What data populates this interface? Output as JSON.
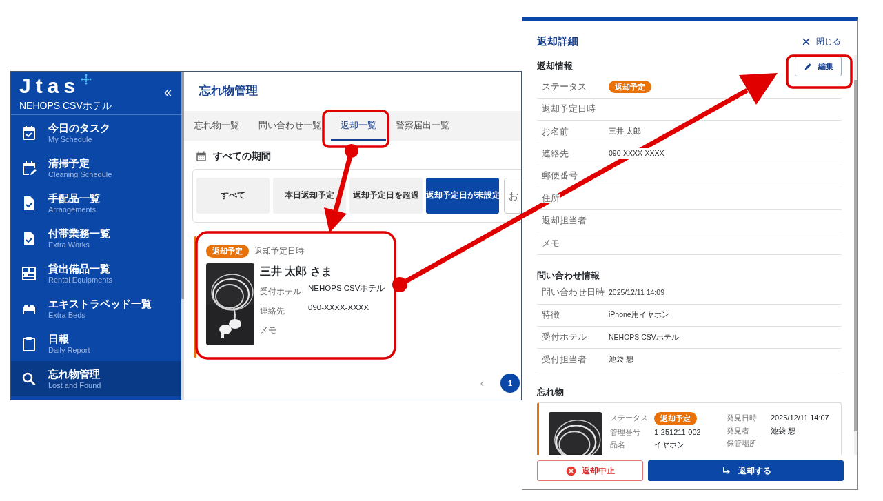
{
  "sidebar": {
    "logo": "Jtas",
    "hotel": "NEHOPS CSVホテル",
    "collapse": "«",
    "items": [
      {
        "label": "今日のタスク",
        "sublabel": "My Schedule",
        "selected": false
      },
      {
        "label": "清掃予定",
        "sublabel": "Cleaning Schedule",
        "selected": false
      },
      {
        "label": "手配品一覧",
        "sublabel": "Arrangements",
        "selected": false
      },
      {
        "label": "付帯業務一覧",
        "sublabel": "Extra Works",
        "selected": false
      },
      {
        "label": "貸出備品一覧",
        "sublabel": "Rental Equipments",
        "selected": false
      },
      {
        "label": "エキストラベッド一覧",
        "sublabel": "Extra Beds",
        "selected": false
      },
      {
        "label": "日報",
        "sublabel": "Daily Report",
        "selected": false
      },
      {
        "label": "忘れ物管理",
        "sublabel": "Lost and Found",
        "selected": true
      }
    ]
  },
  "page": {
    "title": "忘れ物管理",
    "tabs": [
      {
        "label": "忘れ物一覧",
        "selected": false
      },
      {
        "label": "問い合わせ一覧",
        "selected": false
      },
      {
        "label": "返却一覧",
        "selected": true
      },
      {
        "label": "警察届出一覧",
        "selected": false
      }
    ],
    "period": "すべての期間",
    "filters": [
      {
        "label": "すべて",
        "selected": false
      },
      {
        "label": "本日返却予定",
        "selected": false
      },
      {
        "label": "返却予定日を超過",
        "selected": false
      },
      {
        "label": "返却予定日が未設定",
        "selected": true
      }
    ],
    "search": {
      "placeholder": "お"
    },
    "cards": [
      {
        "status": "返却予定",
        "date_label": "返却予定日時",
        "name": "三井 太郎 さま",
        "fields": [
          {
            "label": "受付ホテル",
            "value": "NEHOPS CSVホテル"
          },
          {
            "label": "連絡先",
            "value": "090-XXXX-XXXX"
          },
          {
            "label": "メモ"
          }
        ]
      }
    ],
    "pagination": {
      "prev": "‹",
      "pages": [
        {
          "label": "1",
          "selected": true
        }
      ]
    }
  },
  "detail": {
    "title": "返却詳細",
    "close": "閉じる",
    "sections": [
      {
        "title": "返却情報",
        "edit": "編集",
        "rows": [
          {
            "label": "ステータス",
            "badge": "返却予定"
          },
          {
            "label": "返却予定日時"
          },
          {
            "label": "お名前",
            "value": "三井 太郎"
          },
          {
            "label": "連絡先",
            "value": "090-XXXX-XXXX"
          },
          {
            "label": "郵便番号"
          },
          {
            "label": "住所"
          },
          {
            "label": "返却担当者"
          },
          {
            "label": "メモ"
          }
        ]
      },
      {
        "title": "問い合わせ情報",
        "rows": [
          {
            "label": "問い合わせ日時",
            "value": "2025/12/11 14:09"
          },
          {
            "label": "特徴",
            "value": "iPhone用イヤホン"
          },
          {
            "label": "受付ホテル",
            "value": "NEHOPS CSVホテル"
          },
          {
            "label": "受付担当者",
            "value": "池袋 想"
          }
        ]
      },
      {
        "title": "忘れ物",
        "item": {
          "left": [
            {
              "label": "ステータス",
              "badge": "返却予定"
            },
            {
              "label": "管理番号",
              "value": "1-251211-002"
            },
            {
              "label": "品名",
              "value": "イヤホン"
            }
          ],
          "right": [
            {
              "label": "発見日時",
              "value": "2025/12/11 14:07"
            },
            {
              "label": "発見者",
              "value": "池袋 想"
            },
            {
              "label": "保管場所"
            }
          ]
        }
      }
    ],
    "buttons": [
      {
        "label": "返却中止",
        "kind": "cancel"
      },
      {
        "label": "返却する",
        "kind": "primary"
      }
    ]
  }
}
